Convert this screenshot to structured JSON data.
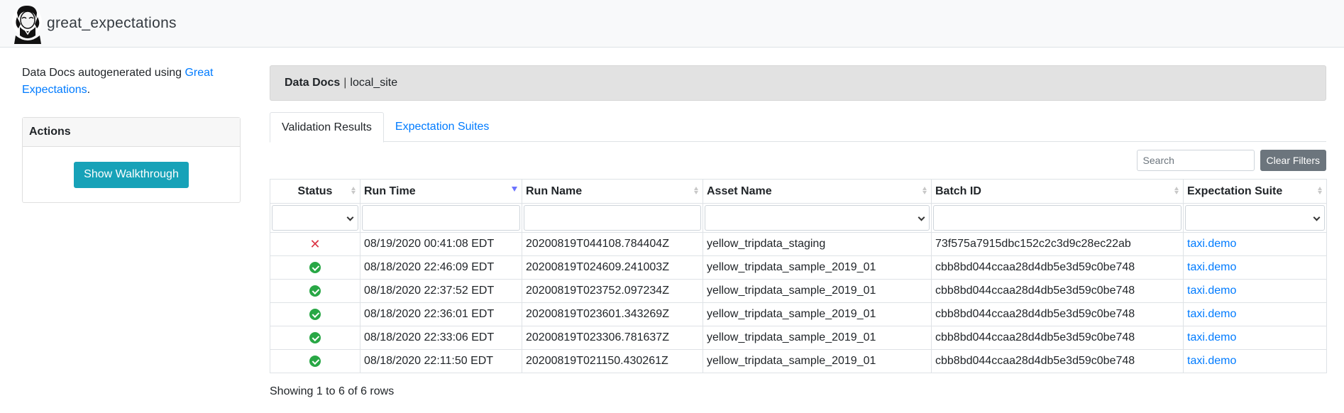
{
  "navbar": {
    "brand": "great_expectations"
  },
  "sidebar": {
    "intro_prefix": "Data Docs autogenerated using ",
    "intro_link": "Great Expectations",
    "intro_suffix": ".",
    "actions_title": "Actions",
    "walkthrough_label": "Show Walkthrough"
  },
  "breadcrumb": {
    "title": "Data Docs",
    "separator": "|",
    "site": "local_site"
  },
  "tabs": {
    "validation": "Validation Results",
    "suites": "Expectation Suites"
  },
  "toolbar": {
    "search_placeholder": "Search",
    "clear_label": "Clear Filters"
  },
  "table": {
    "columns": [
      "Status",
      "Run Time",
      "Run Name",
      "Asset Name",
      "Batch ID",
      "Expectation Suite"
    ],
    "sort_column": "Run Time",
    "rows": [
      {
        "status": "failed",
        "run_time": "08/19/2020 00:41:08 EDT",
        "run_name": "20200819T044108.784404Z",
        "asset": "yellow_tripdata_staging",
        "batch": "73f575a7915dbc152c2c3d9c28ec22ab",
        "suite": "taxi.demo"
      },
      {
        "status": "success",
        "run_time": "08/18/2020 22:46:09 EDT",
        "run_name": "20200819T024609.241003Z",
        "asset": "yellow_tripdata_sample_2019_01",
        "batch": "cbb8bd044ccaa28d4db5e3d59c0be748",
        "suite": "taxi.demo"
      },
      {
        "status": "success",
        "run_time": "08/18/2020 22:37:52 EDT",
        "run_name": "20200819T023752.097234Z",
        "asset": "yellow_tripdata_sample_2019_01",
        "batch": "cbb8bd044ccaa28d4db5e3d59c0be748",
        "suite": "taxi.demo"
      },
      {
        "status": "success",
        "run_time": "08/18/2020 22:36:01 EDT",
        "run_name": "20200819T023601.343269Z",
        "asset": "yellow_tripdata_sample_2019_01",
        "batch": "cbb8bd044ccaa28d4db5e3d59c0be748",
        "suite": "taxi.demo"
      },
      {
        "status": "success",
        "run_time": "08/18/2020 22:33:06 EDT",
        "run_name": "20200819T023306.781637Z",
        "asset": "yellow_tripdata_sample_2019_01",
        "batch": "cbb8bd044ccaa28d4db5e3d59c0be748",
        "suite": "taxi.demo"
      },
      {
        "status": "success",
        "run_time": "08/18/2020 22:11:50 EDT",
        "run_name": "20200819T021150.430261Z",
        "asset": "yellow_tripdata_sample_2019_01",
        "batch": "cbb8bd044ccaa28d4db5e3d59c0be748",
        "suite": "taxi.demo"
      }
    ]
  },
  "footer": {
    "showing": "Showing 1 to 6 of 6 rows"
  },
  "colors": {
    "link": "#007bff",
    "success": "#28a745",
    "failure": "#dc3545",
    "info_button": "#17a2b8",
    "secondary_button": "#6c757d"
  },
  "icons": {
    "success": "check-circle-icon",
    "failed": "x-icon",
    "logo": "great-expectations-logo-icon"
  }
}
